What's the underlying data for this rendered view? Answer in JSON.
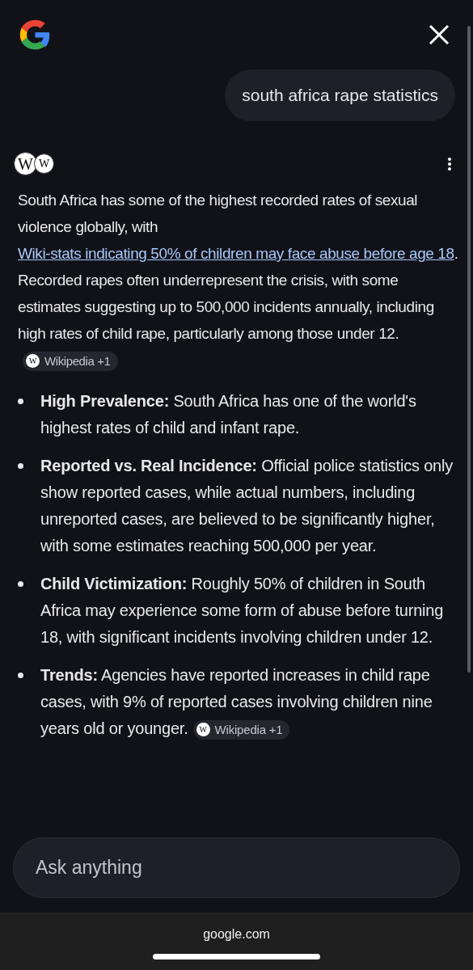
{
  "query": "south africa rape statistics",
  "sources": [
    {
      "letter": "W"
    },
    {
      "letter": "W"
    }
  ],
  "answer": {
    "before": "South Africa has some of the highest recorded rates of sexual violence globally, with ",
    "link": "Wiki-stats indicating 50% of children may face abuse before age 18",
    "after": ". Recorded rapes often underrepresent the crisis, with some estimates suggesting up to 500,000 incidents annually, including high rates of child rape, particularly among those under 12.",
    "source": {
      "letter": "W",
      "label": "Wikipedia +1"
    }
  },
  "bullets": [
    {
      "title": "High Prevalence:",
      "text": "South Africa has one of the world's highest rates of child and infant rape."
    },
    {
      "title": "Reported vs. Real Incidence:",
      "text": "Official police statistics only show reported cases, while actual numbers, including unreported cases, are believed to be significantly higher, with some estimates reaching 500,000 per year."
    },
    {
      "title": "Child Victimization:",
      "text": "Roughly 50% of children in South Africa may experience some form of abuse before turning 18, with significant incidents involving children under 12."
    },
    {
      "title": "Trends:",
      "text": "Agencies have reported increases in child rape cases, with 9% of reported cases involving children nine years old or younger.",
      "source": {
        "letter": "W",
        "label": "Wikipedia +1"
      }
    }
  ],
  "input": {
    "placeholder": "Ask anything"
  },
  "footer": {
    "url": "google.com"
  }
}
